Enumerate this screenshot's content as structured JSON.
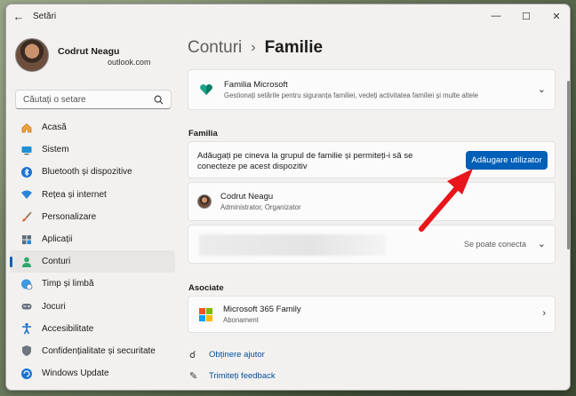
{
  "window": {
    "title": "Setări"
  },
  "profile": {
    "name": "Codrut Neagu",
    "email": "outlook.com"
  },
  "search": {
    "placeholder": "Căutați o setare"
  },
  "nav": [
    {
      "label": "Acasă",
      "icon": "home-icon"
    },
    {
      "label": "Sistem",
      "icon": "monitor-icon"
    },
    {
      "label": "Bluetooth și dispozitive",
      "icon": "bluetooth-icon"
    },
    {
      "label": "Rețea și internet",
      "icon": "wifi-icon"
    },
    {
      "label": "Personalizare",
      "icon": "brush-icon"
    },
    {
      "label": "Aplicații",
      "icon": "apps-icon"
    },
    {
      "label": "Conturi",
      "icon": "person-icon",
      "active": true
    },
    {
      "label": "Timp și limbă",
      "icon": "globe-clock-icon"
    },
    {
      "label": "Jocuri",
      "icon": "gamepad-icon"
    },
    {
      "label": "Accesibilitate",
      "icon": "accessibility-icon"
    },
    {
      "label": "Confidențialitate și securitate",
      "icon": "shield-icon"
    },
    {
      "label": "Windows Update",
      "icon": "update-icon"
    }
  ],
  "breadcrumb": {
    "parent": "Conturi",
    "current": "Familie"
  },
  "family_app": {
    "title": "Familia Microsoft",
    "subtitle": "Gestionați setările pentru siguranța familiei, vedeți activitatea familiei și multe altele"
  },
  "family": {
    "heading": "Familia",
    "add_text": "Adăugați pe cineva la grupul de familie și permiteți-i să se conecteze pe acest dispozitiv",
    "add_button": "Adăugare utilizator",
    "members": [
      {
        "name": "Codrut Neagu",
        "role": "Administrator, Organizator"
      }
    ],
    "hidden_member_status": "Se poate conecta"
  },
  "associated": {
    "heading": "Asociate",
    "title": "Microsoft 365 Family",
    "subtitle": "Abonament"
  },
  "links": {
    "help": "Obținere ajutor",
    "feedback": "Trimiteți feedback"
  },
  "colors": {
    "accent": "#005fb8",
    "arrow": "#e8151b"
  }
}
